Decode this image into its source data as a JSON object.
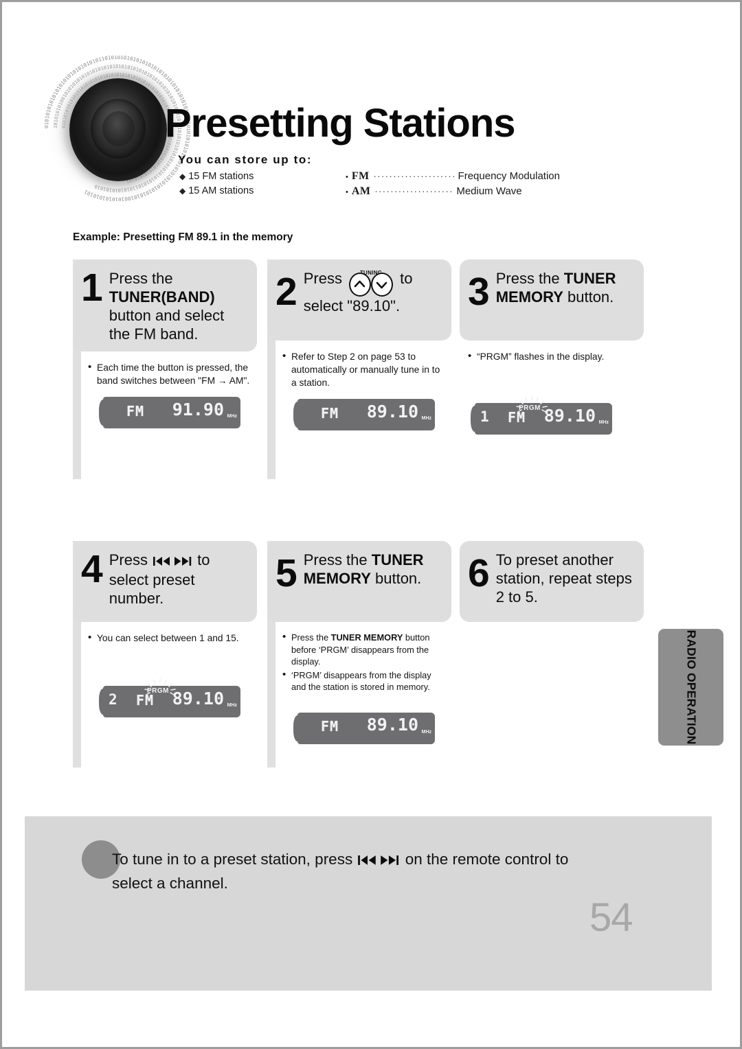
{
  "page": {
    "title": "Presetting Stations",
    "number": "54",
    "side_tab": "RADIO OPERATION"
  },
  "header": {
    "store_label": "You can store up to:",
    "store_items": [
      "15 FM stations",
      "15 AM stations"
    ],
    "bands": [
      {
        "abbr": "FM",
        "dots": "········································",
        "full": "Frequency Modulation"
      },
      {
        "abbr": "AM",
        "dots": "·········································",
        "full": "Medium Wave"
      }
    ],
    "example": "Example: Presetting FM 89.1 in the memory"
  },
  "steps": [
    {
      "num": "1",
      "text_part1": "Press the ",
      "text_bold": "TUNER(BAND)",
      "text_part2": " button and select the FM band.",
      "notes": [
        {
          "pre": "Each time the button is pressed, the band switches between \"FM → AM\"."
        }
      ],
      "lcd": {
        "preset": "",
        "band": "FM",
        "freq": "91.90",
        "unit": "MHz",
        "prgm": ""
      }
    },
    {
      "num": "2",
      "text_part1": "Press ",
      "tuning_label": "TUNING",
      "text_part2": " to select \"89.10\".",
      "notes": [
        {
          "pre": "Refer to Step 2 on page 53 to automatically or manually tune in to a station."
        }
      ],
      "lcd": {
        "preset": "",
        "band": "FM",
        "freq": "89.10",
        "unit": "MHz",
        "prgm": ""
      }
    },
    {
      "num": "3",
      "text_part1": "Press the ",
      "text_bold": "TUNER MEMORY",
      "text_part2": " button.",
      "notes": [
        {
          "pre": "“PRGM” flashes in the display."
        }
      ],
      "lcd": {
        "preset": "1",
        "band": "FM",
        "freq": "89.10",
        "unit": "MHz",
        "prgm": "PRGM"
      }
    },
    {
      "num": "4",
      "text_part1": "Press ",
      "text_part2": " to select preset number.",
      "notes": [
        {
          "pre": "You can select between 1 and 15."
        }
      ],
      "lcd": {
        "preset": "2",
        "band": "FM",
        "freq": "89.10",
        "unit": "MHz",
        "prgm": "PRGM"
      }
    },
    {
      "num": "5",
      "text_part1": "Press the ",
      "text_bold": "TUNER MEMORY",
      "text_part2": " button.",
      "notes": [
        {
          "pre": "Press the ",
          "bold": "TUNER MEMORY",
          "post": " button before ‘PRGM’ disappears from the display."
        },
        {
          "pre": "‘PRGM’ disappears from the display and the station is stored in memory."
        }
      ],
      "lcd": {
        "preset": "",
        "band": "FM",
        "freq": "89.10",
        "unit": "MHz",
        "prgm": ""
      }
    },
    {
      "num": "6",
      "text_part1": "To preset another station, repeat steps 2 to 5.",
      "notes": [],
      "lcd": null
    }
  ],
  "tip": {
    "line1": "To tune in to a preset station, press ",
    "line2": " on the remote control to select a channel."
  }
}
